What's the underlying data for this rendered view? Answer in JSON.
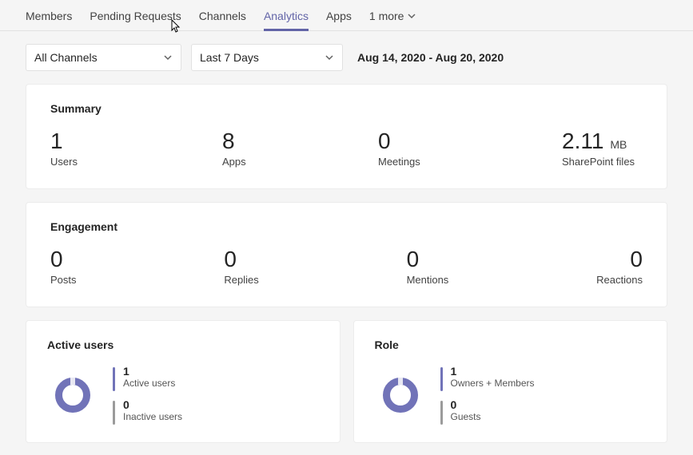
{
  "tabs": {
    "members": "Members",
    "pending": "Pending Requests",
    "channels": "Channels",
    "analytics": "Analytics",
    "apps": "Apps",
    "more": "1 more"
  },
  "filters": {
    "channels": "All Channels",
    "period": "Last 7 Days",
    "range": "Aug 14, 2020 - Aug 20, 2020"
  },
  "summary": {
    "title": "Summary",
    "stats": [
      {
        "value": "1",
        "unit": "",
        "label": "Users"
      },
      {
        "value": "8",
        "unit": "",
        "label": "Apps"
      },
      {
        "value": "0",
        "unit": "",
        "label": "Meetings"
      },
      {
        "value": "2.11",
        "unit": "MB",
        "label": "SharePoint files"
      }
    ]
  },
  "engagement": {
    "title": "Engagement",
    "stats": [
      {
        "value": "0",
        "label": "Posts"
      },
      {
        "value": "0",
        "label": "Replies"
      },
      {
        "value": "0",
        "label": "Mentions"
      },
      {
        "value": "0",
        "label": "Reactions"
      }
    ]
  },
  "active_users": {
    "title": "Active users",
    "legend": [
      {
        "value": "1",
        "label": "Active users",
        "color": "purple"
      },
      {
        "value": "0",
        "label": "Inactive users",
        "color": "grey"
      }
    ]
  },
  "role": {
    "title": "Role",
    "legend": [
      {
        "value": "1",
        "label": "Owners + Members",
        "color": "purple"
      },
      {
        "value": "0",
        "label": "Guests",
        "color": "grey"
      }
    ]
  },
  "chart_data": [
    {
      "type": "pie",
      "title": "Active users",
      "categories": [
        "Active users",
        "Inactive users"
      ],
      "values": [
        1,
        0
      ]
    },
    {
      "type": "pie",
      "title": "Role",
      "categories": [
        "Owners + Members",
        "Guests"
      ],
      "values": [
        1,
        0
      ]
    }
  ]
}
